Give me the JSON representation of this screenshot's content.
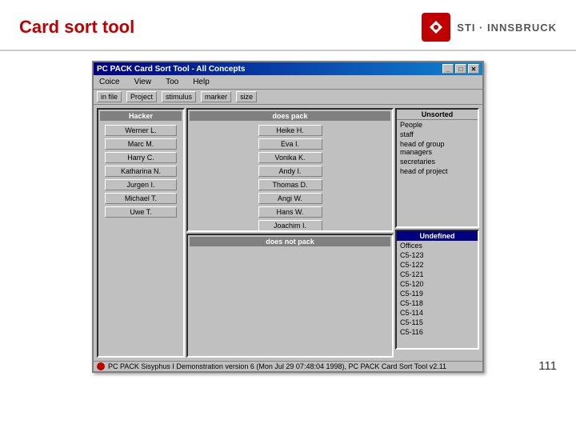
{
  "header": {
    "title": "Card sort tool",
    "logo_text": "STI · INNSBRUCK"
  },
  "dialog": {
    "title": "PC PACK Card Sort Tool - All Concepts",
    "menu_items": [
      "Coice",
      "View",
      "Too",
      "Help"
    ],
    "toolbar_items": [
      "in file",
      "Project",
      "stimulus",
      "marker",
      "size"
    ],
    "panels": {
      "hacker": {
        "title": "Hacker",
        "people": [
          "Werner L.",
          "Marc M.",
          "Harry C.",
          "Katharina N.",
          "Jurgen I.",
          "Michael T.",
          "Uwe T."
        ]
      },
      "does_pack": {
        "title": "does pack",
        "items": [
          "Heike H.",
          "Eva I.",
          "Vonika K.",
          "Andy I.",
          "Thomas D.",
          "Angi W.",
          "Hans W.",
          "Joachim I."
        ]
      },
      "does_not_pack": {
        "title": "does not pack",
        "items": []
      },
      "unsorted": {
        "title": "Unsorted",
        "items": [
          "People",
          "staff",
          "head of group managers",
          "secretaries",
          "head of project"
        ]
      },
      "undefined": {
        "title": "Undefined",
        "items": [
          "Offices",
          "C5-123",
          "C5-122",
          "C5-121",
          "C5-120",
          "C5-119",
          "C5-118",
          "C5-114",
          "C5-115",
          "C5-116"
        ]
      }
    },
    "statusbar": "PC PACK Sisyphus I Demonstration   version 6 (Mon Jul 29 07:48:04 1998), PC PACK Card Sort Tool v2.11"
  },
  "page_number": "111"
}
